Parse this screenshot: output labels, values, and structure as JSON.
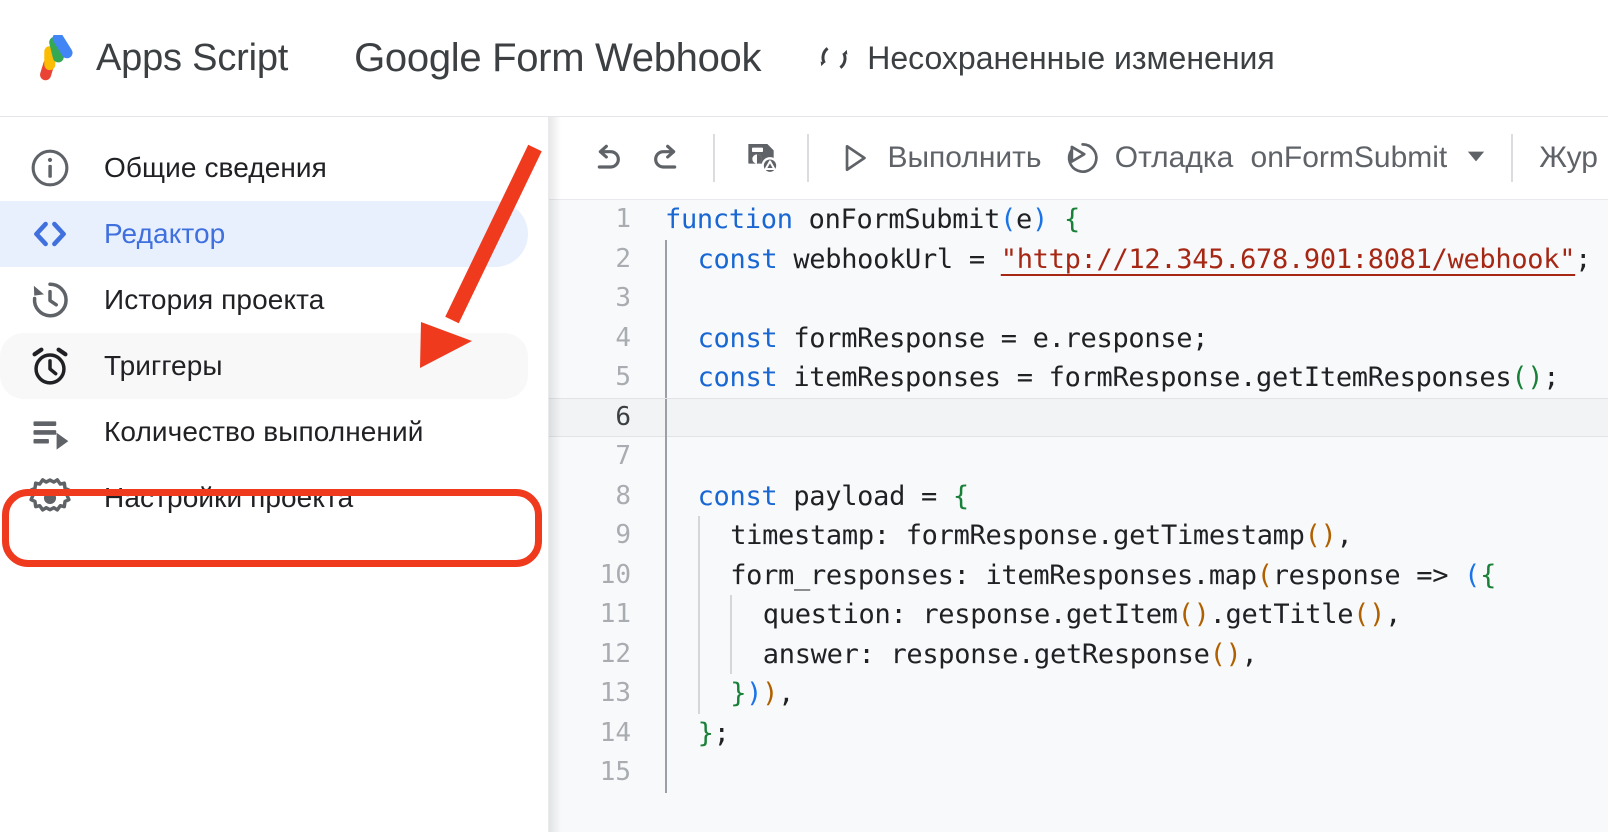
{
  "header": {
    "brand_name": "Apps Script",
    "brand_logo_icon": "apps-script-logo",
    "doc_title": "Google Form Webhook",
    "save_state_icon": "sync-icon",
    "save_state_text": "Несохраненные изменения"
  },
  "sidebar": {
    "items": [
      {
        "label": "Общие сведения",
        "icon": "info-circle-icon",
        "state": "default"
      },
      {
        "label": "Редактор",
        "icon": "code-brackets-icon",
        "state": "active"
      },
      {
        "label": "История проекта",
        "icon": "history-clock-icon",
        "state": "default"
      },
      {
        "label": "Триггеры",
        "icon": "alarm-clock-icon",
        "state": "highlight"
      },
      {
        "label": "Количество выполнений",
        "icon": "executions-list-play-icon",
        "state": "default"
      },
      {
        "label": "Настройки проекта",
        "icon": "gear-icon",
        "state": "default"
      }
    ]
  },
  "annotation": {
    "color": "#ef3a1e",
    "target_label": "Триггеры",
    "arrow_icon": "red-pointer-arrow"
  },
  "toolbar": {
    "undo_icon": "undo-icon",
    "redo_icon": "redo-icon",
    "save_icon": "save-to-drive-icon",
    "run_icon": "play-triangle-icon",
    "run_label": "Выполнить",
    "debug_icon": "debug-icon",
    "debug_label": "Отладка",
    "function_select_value": "onFormSubmit",
    "function_select_caret_icon": "chevron-down-icon",
    "logs_label": "Жур"
  },
  "code": {
    "active_line": 6,
    "lines": [
      {
        "n": 1,
        "indent": 0,
        "tokens": [
          {
            "t": "function",
            "c": "kw"
          },
          {
            "t": " onFormSubmit",
            "c": "plain"
          },
          {
            "t": "(",
            "c": "b1"
          },
          {
            "t": "e",
            "c": "plain"
          },
          {
            "t": ")",
            "c": "b1"
          },
          {
            "t": " ",
            "c": "plain"
          },
          {
            "t": "{",
            "c": "b2"
          }
        ]
      },
      {
        "n": 2,
        "indent": 1,
        "tokens": [
          {
            "t": "const",
            "c": "kw"
          },
          {
            "t": " webhookUrl = ",
            "c": "plain"
          },
          {
            "t": "\"http://12.345.678.901:8081/webhook\"",
            "c": "str"
          },
          {
            "t": ";",
            "c": "plain"
          }
        ]
      },
      {
        "n": 3,
        "indent": 1,
        "tokens": []
      },
      {
        "n": 4,
        "indent": 1,
        "tokens": [
          {
            "t": "const",
            "c": "kw"
          },
          {
            "t": " formResponse = e.response;",
            "c": "plain"
          }
        ]
      },
      {
        "n": 5,
        "indent": 1,
        "tokens": [
          {
            "t": "const",
            "c": "kw"
          },
          {
            "t": " itemResponses = formResponse.getItemResponses",
            "c": "plain"
          },
          {
            "t": "()",
            "c": "b2"
          },
          {
            "t": ";",
            "c": "plain"
          }
        ]
      },
      {
        "n": 6,
        "indent": 1,
        "tokens": []
      },
      {
        "n": 7,
        "indent": 1,
        "tokens": []
      },
      {
        "n": 8,
        "indent": 1,
        "tokens": [
          {
            "t": "const",
            "c": "kw"
          },
          {
            "t": " payload = ",
            "c": "plain"
          },
          {
            "t": "{",
            "c": "b2"
          }
        ]
      },
      {
        "n": 9,
        "indent": 2,
        "tokens": [
          {
            "t": "timestamp: formResponse.getTimestamp",
            "c": "plain"
          },
          {
            "t": "()",
            "c": "b3"
          },
          {
            "t": ",",
            "c": "plain"
          }
        ]
      },
      {
        "n": 10,
        "indent": 2,
        "tokens": [
          {
            "t": "form_responses: itemResponses.map",
            "c": "plain"
          },
          {
            "t": "(",
            "c": "b3"
          },
          {
            "t": "response => ",
            "c": "plain"
          },
          {
            "t": "(",
            "c": "b1"
          },
          {
            "t": "{",
            "c": "b2"
          }
        ]
      },
      {
        "n": 11,
        "indent": 3,
        "tokens": [
          {
            "t": "question: response.getItem",
            "c": "plain"
          },
          {
            "t": "()",
            "c": "b3"
          },
          {
            "t": ".getTitle",
            "c": "plain"
          },
          {
            "t": "()",
            "c": "b3"
          },
          {
            "t": ",",
            "c": "plain"
          }
        ]
      },
      {
        "n": 12,
        "indent": 3,
        "tokens": [
          {
            "t": "answer: response.getResponse",
            "c": "plain"
          },
          {
            "t": "()",
            "c": "b3"
          },
          {
            "t": ",",
            "c": "plain"
          }
        ]
      },
      {
        "n": 13,
        "indent": 2,
        "tokens": [
          {
            "t": "}",
            "c": "b2"
          },
          {
            "t": ")",
            "c": "b1"
          },
          {
            "t": ")",
            "c": "b3"
          },
          {
            "t": ",",
            "c": "plain"
          }
        ]
      },
      {
        "n": 14,
        "indent": 1,
        "tokens": [
          {
            "t": "}",
            "c": "b2"
          },
          {
            "t": ";",
            "c": "plain"
          }
        ]
      },
      {
        "n": 15,
        "indent": 1,
        "tokens": []
      }
    ]
  }
}
